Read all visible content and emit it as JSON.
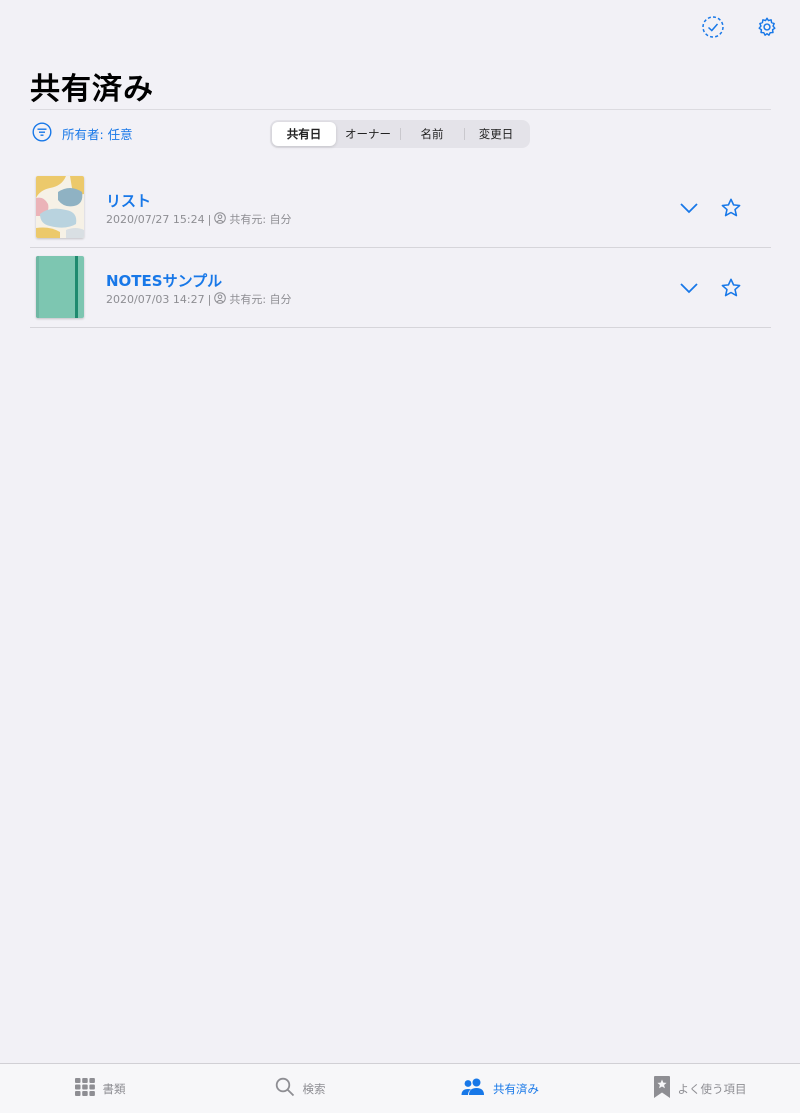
{
  "header": {
    "title": "共有済み",
    "icons": [
      "select-check-icon",
      "gear-icon"
    ]
  },
  "filter": {
    "label": "所有者: 任意",
    "icon": "filter-lines-icon"
  },
  "sort_tabs": [
    {
      "label": "共有日",
      "active": true
    },
    {
      "label": "オーナー",
      "active": false
    },
    {
      "label": "名前",
      "active": false
    },
    {
      "label": "変更日",
      "active": false
    }
  ],
  "items": [
    {
      "title": "リスト",
      "date": "2020/07/27 15:24",
      "shared_from": "共有元: 自分",
      "thumbnail": "abstract-pastel-cover"
    },
    {
      "title": "NOTESサンプル",
      "date": "2020/07/03 14:27",
      "shared_from": "共有元: 自分",
      "thumbnail": "teal-notebook-cover"
    }
  ],
  "tabbar": [
    {
      "label": "書類",
      "icon": "grid-icon",
      "active": false
    },
    {
      "label": "検索",
      "icon": "search-icon",
      "active": false
    },
    {
      "label": "共有済み",
      "icon": "people-icon",
      "active": true
    },
    {
      "label": "よく使う項目",
      "icon": "bookmark-star-icon",
      "active": false
    }
  ],
  "colors": {
    "accent": "#1878e8",
    "background": "#f2f1f6",
    "secondary_text": "#8e8e93"
  }
}
